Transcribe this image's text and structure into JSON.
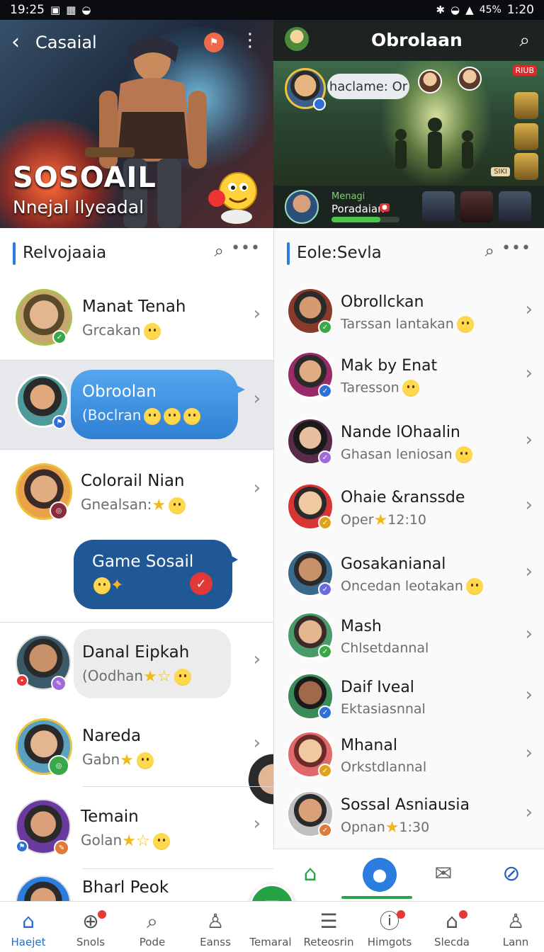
{
  "status": {
    "time": "19:25",
    "right_time": "1:20",
    "battery": "45%"
  },
  "hero": {
    "header_title": "Casaial",
    "brand": "SOSOAIL",
    "tagline": "Nnejal Ilyeadal"
  },
  "chat_header": {
    "title": "Obrolaan",
    "bubble": "haclame: Or",
    "live": "RIUB",
    "tag": "SIKI",
    "bar_label_top": "Menagi",
    "bar_label": "Poradaian",
    "progress": 0.72
  },
  "left_panel": {
    "title": "Relvojaaia",
    "contacts": [
      {
        "name": "Manat Tenah",
        "sub": "Grcakan"
      },
      {
        "name": "Obroolan",
        "sub": "(Boclran"
      },
      {
        "name": "Colorail Nian",
        "sub": "Gnealsan:"
      },
      {
        "name": "Danal Eipkah",
        "sub": "(Oodhan"
      },
      {
        "name": "Nareda",
        "sub": "Gabn"
      },
      {
        "name": "Temain",
        "sub": "Golan"
      },
      {
        "name": "Bharl Peok",
        "sub": ""
      }
    ],
    "group": {
      "name": "Game Sosail"
    }
  },
  "right_panel": {
    "title": "Eole:Sevla",
    "contacts": [
      {
        "name": "Obrollckan",
        "sub": "Tarssan lantakan"
      },
      {
        "name": "Mak by Enat",
        "sub": "Taresson"
      },
      {
        "name": "Nande lOhaalin",
        "sub": "Ghasan leniosan"
      },
      {
        "name": "Ohaie &ranssde",
        "sub": "Oper",
        "time": "12:10"
      },
      {
        "name": "Gosakanianal",
        "sub": "Oncedan leotakan"
      },
      {
        "name": "Mash",
        "sub": "Chlsetdannal"
      },
      {
        "name": "Daif Iveal",
        "sub": "Ektasiasnnal"
      },
      {
        "name": "Mhanal",
        "sub": "Orkstdlannal"
      },
      {
        "name": "Sossal Asniausia",
        "sub": "Opnan",
        "time": "1:30"
      }
    ]
  },
  "tabs": [
    {
      "label": "Haejet",
      "icon": "home-icon",
      "active": true
    },
    {
      "label": "Snols",
      "icon": "globe-icon"
    },
    {
      "label": "Pode",
      "icon": "search-icon"
    },
    {
      "label": "Eanss",
      "icon": "person-icon"
    },
    {
      "label": "Temaral",
      "icon": "chat-icon"
    },
    {
      "label": "Reteosrin",
      "icon": "list-icon"
    },
    {
      "label": "Himgots",
      "icon": "info-icon"
    },
    {
      "label": "Slecda",
      "icon": "bag-icon"
    },
    {
      "label": "Lann",
      "icon": "profile-icon"
    }
  ],
  "colors": {
    "accent": "#2b7de0",
    "green": "#25a244",
    "bubble_blue": "#3b8fe0",
    "bubble_navy": "#1f5797"
  }
}
